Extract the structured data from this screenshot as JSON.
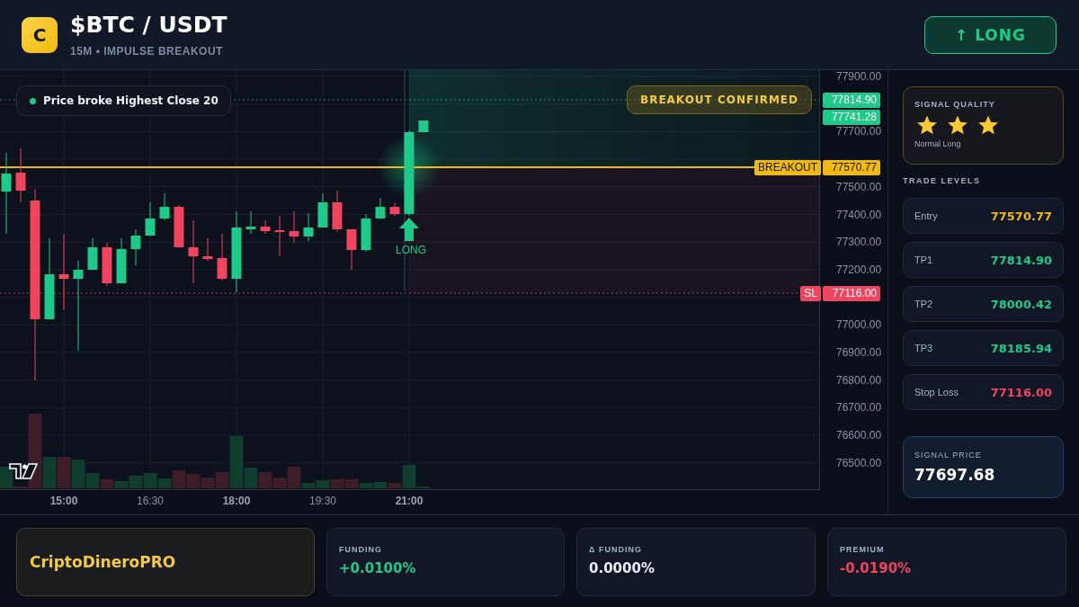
{
  "header": {
    "logo_letter": "C",
    "title": "$BTC / USDT",
    "subtitle": "15M • IMPULSE BREAKOUT",
    "action_button": "↑ LONG"
  },
  "chart": {
    "note": "Price broke Highest Close 20",
    "badge": "BREAKOUT CONFIRMED",
    "signal_label": "LONG",
    "price_tags": [
      {
        "kind": "target",
        "value": "77814.90"
      },
      {
        "kind": "last",
        "value": "77741.28"
      },
      {
        "kind": "entry",
        "label": "BREAKOUT",
        "value": "77570.77"
      },
      {
        "kind": "stop",
        "label": "SL",
        "value": "77116.00"
      }
    ],
    "price_axis": [
      "77900.00",
      "77700.00",
      "77500.00",
      "77400.00",
      "77300.00",
      "77200.00",
      "77000.00",
      "76900.00",
      "76800.00",
      "76700.00",
      "76600.00",
      "76500.00"
    ],
    "time_axis": [
      {
        "label": "15:00",
        "major": true
      },
      {
        "label": "16:30",
        "major": false
      },
      {
        "label": "18:00",
        "major": true
      },
      {
        "label": "19:30",
        "major": false
      },
      {
        "label": "21:00",
        "major": true
      }
    ]
  },
  "signal_quality": {
    "title": "SIGNAL QUALITY",
    "stars": 3,
    "caption": "Normal Long"
  },
  "trade_levels": {
    "title": "TRADE LEVELS",
    "rows": [
      {
        "label": "Entry",
        "value": "77570.77",
        "color": "#f0b90b"
      },
      {
        "label": "TP1",
        "value": "77814.90",
        "color": "#1ec98a"
      },
      {
        "label": "TP2",
        "value": "78000.42",
        "color": "#1ec98a"
      },
      {
        "label": "TP3",
        "value": "78185.94",
        "color": "#1ec98a"
      },
      {
        "label": "Stop Loss",
        "value": "77116.00",
        "color": "#f0445f"
      }
    ]
  },
  "signal_price": {
    "label": "SIGNAL PRICE",
    "value": "77697.68"
  },
  "footer": {
    "brand": "CriptoDineroPRO",
    "metrics": [
      {
        "label": "FUNDING",
        "value": "+0.0100%",
        "color": "#1ec98a"
      },
      {
        "label": "Δ FUNDING",
        "value": "0.0000%",
        "color": "#e8edf5"
      },
      {
        "label": "PREMIUM",
        "value": "-0.0190%",
        "color": "#f0445f"
      }
    ]
  }
}
